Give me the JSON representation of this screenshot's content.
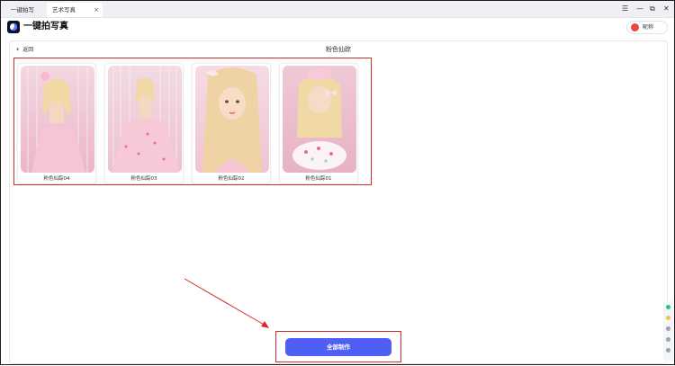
{
  "tabs": [
    {
      "label": "一键拍写真",
      "active": false
    },
    {
      "label": "艺术写真",
      "active": true
    }
  ],
  "tab_close_glyph": "×",
  "window_controls": {
    "menu": "☰",
    "minimize": "—",
    "restore": "⧉",
    "close": "✕"
  },
  "app": {
    "title": "一键拍写真",
    "logo_icon": "moon-logo-icon"
  },
  "user": {
    "name": "昵称",
    "avatar_color": "#e8473f"
  },
  "nav": {
    "back_label": "返回",
    "back_glyph": "‹"
  },
  "section": {
    "title": "粉色仙踪"
  },
  "gallery": [
    {
      "label": "粉色仙踪04"
    },
    {
      "label": "粉色仙踪03"
    },
    {
      "label": "粉色仙踪02"
    },
    {
      "label": "粉色仙踪01"
    }
  ],
  "actions": {
    "make_all_label": "全部制作"
  },
  "colors": {
    "accent": "#4f5ff5",
    "highlight": "#d62a2a",
    "photo_pink": "#f4c8d6"
  }
}
